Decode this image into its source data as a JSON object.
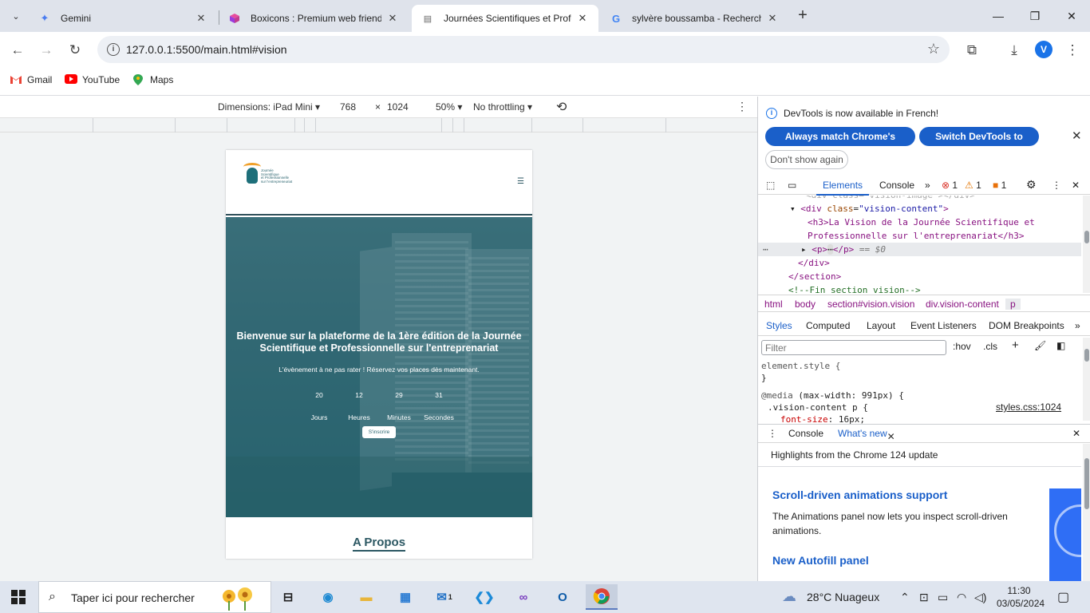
{
  "browser": {
    "tabs": [
      {
        "title": "Gemini",
        "icon": "gemini-icon"
      },
      {
        "title": "Boxicons : Premium web friendly",
        "icon": "boxicons-icon"
      },
      {
        "title": "Journées Scientifiques et Profess",
        "icon": "page-icon"
      },
      {
        "title": "sylvère boussamba - Recherche",
        "icon": "google-icon"
      }
    ],
    "url": "127.0.0.1:5500/main.html#vision",
    "profile_initial": "V",
    "bookmarks": [
      "Gmail",
      "YouTube",
      "Maps"
    ]
  },
  "device_toolbar": {
    "dimensions_label": "Dimensions: iPad Mini",
    "width": "768",
    "times": "×",
    "height": "1024",
    "zoom": "50%",
    "throttling": "No throttling"
  },
  "site": {
    "logo_text": "Journée\nScientifique\net Professionnelle\nsur l'entrepreneuriat",
    "hero_title": "Bienvenue sur la plateforme de la 1ère édition de la Journée Scientifique et Professionnelle sur l'entreprenariat",
    "hero_subtitle": "L'évènement à ne pas rater ! Réservez vos places dès maintenant.",
    "countdown": [
      {
        "value": "20",
        "unit": "Jours"
      },
      {
        "value": "12",
        "unit": "Heures"
      },
      {
        "value": "29",
        "unit": "Minutes"
      },
      {
        "value": "31",
        "unit": "Secondes"
      }
    ],
    "cta_label": "S'inscrire",
    "section_title": "A Propos"
  },
  "devtools": {
    "language_notice": "DevTools is now available in French!",
    "btn_match": "Always match Chrome's language",
    "btn_switch": "Switch DevTools to French",
    "btn_dont_show": "Don't show again",
    "tabs": [
      "Elements",
      "Console"
    ],
    "errors": "1",
    "warnings": "1",
    "issues": "1",
    "dom": {
      "line0": "<div class=\"vision-image\"></div>",
      "line1_tag_open": "<div",
      "line1_attr": "class",
      "line1_val": "\"vision-content\"",
      "line2": "<h3>La Vision de la Journée Scientifique et",
      "line3": "Professionnelle sur l'entreprenariat</h3>",
      "line4_tag": "<p>",
      "line4_close": "</p>",
      "line4_eq": "== $0",
      "line5": "</div>",
      "line6": "</section>",
      "line7": "<!--Fin section vision-->"
    },
    "breadcrumbs": [
      "html",
      "body",
      "section#vision.vision",
      "div.vision-content",
      "p"
    ],
    "style_tabs": [
      "Styles",
      "Computed",
      "Layout",
      "Event Listeners",
      "DOM Breakpoints"
    ],
    "filter_placeholder": "Filter",
    "hov": ":hov",
    "cls": ".cls",
    "css": {
      "element_style": "element.style {",
      "close": "}",
      "media_kw": "@media",
      "media_query": "(max-width: 991px) {",
      "selector": ".vision-content p {",
      "prop": "font-size",
      "value": "16px;",
      "source": "styles.css:1024"
    },
    "drawer_tabs": [
      "Console",
      "What's new"
    ],
    "highlights": "Highlights from the Chrome 124 update",
    "whats_new": [
      {
        "title": "Scroll-driven animations support",
        "body": "The Animations panel now lets you inspect scroll-driven animations."
      },
      {
        "title": "New Autofill panel",
        "body": ""
      }
    ]
  },
  "taskbar": {
    "search_placeholder": "Taper ici pour rechercher",
    "weather": "28°C  Nuageux",
    "time": "11:30",
    "date": "03/05/2024",
    "mail_badge": "1"
  }
}
